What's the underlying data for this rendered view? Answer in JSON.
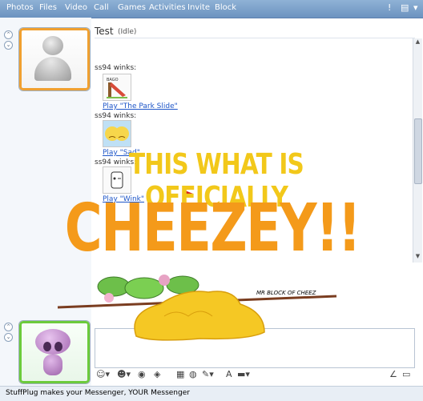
{
  "menu": {
    "items": [
      "Photos",
      "Files",
      "Video",
      "Call",
      "Games",
      "Activities",
      "Invite",
      "Block"
    ],
    "right_icons": [
      "alert-icon",
      "layout-icon",
      "menu-icon"
    ]
  },
  "contact": {
    "name": "Test",
    "status": "(Idle)"
  },
  "conversation": [
    {
      "sender": "ss94 winks:",
      "link": "Play \"The Park Slide\"",
      "icon": "park-slide-wink-icon"
    },
    {
      "sender": "ss94 winks:",
      "link": "Play \"Sad\"",
      "icon": "sad-wink-icon"
    },
    {
      "sender": "ss94 winks:",
      "link": "Play \"Wink\"",
      "icon": "wink-wink-icon"
    }
  ],
  "overlay": {
    "line1": "THIS WHAT IS OFFICIALLY",
    "line2": "CHEEZEY!!",
    "doodle_label": "MR BLOCK OF CHEEZ",
    "line1_color": "#f2c81a",
    "line2_color": "#f49a1a",
    "cheese_color": "#f5c824"
  },
  "toolbar": {
    "buttons": [
      "emoticon-icon",
      "wink-icon",
      "nudge-icon",
      "voice-clip-icon",
      "background-icon",
      "games-icon",
      "font-icon",
      "handwriting-icon",
      "ink-icon"
    ]
  },
  "statusbar": {
    "text": "StuffPlug makes your Messenger, YOUR Messenger"
  }
}
